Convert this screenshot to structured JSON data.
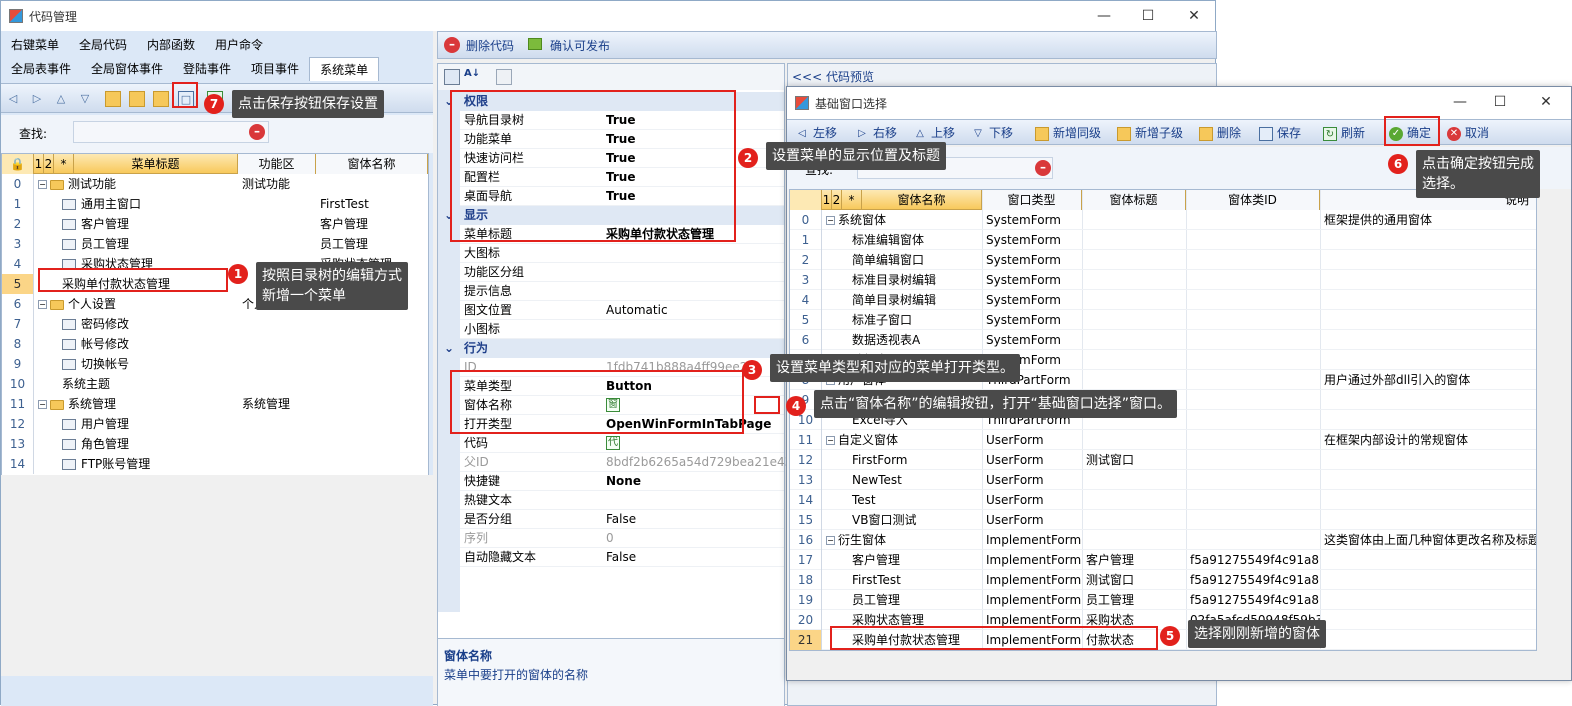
{
  "main_window": {
    "title": "代码管理"
  },
  "left_tabs_row1": [
    "右键菜单",
    "全局代码",
    "内部函数",
    "用户命令"
  ],
  "left_tabs_row2": [
    "全局表事件",
    "全局窗体事件",
    "登陆事件",
    "项目事件",
    "系统菜单"
  ],
  "search": {
    "label": "查找:"
  },
  "left_grid": {
    "headers": [
      "1",
      "2",
      "*",
      "菜单标题",
      "功能区",
      "窗体名称"
    ],
    "rows": [
      {
        "idx": "0",
        "title": "测试功能",
        "area": "测试功能",
        "form": ""
      },
      {
        "idx": "1",
        "title": "通用主窗口",
        "area": "",
        "form": "FirstTest"
      },
      {
        "idx": "2",
        "title": "客户管理",
        "area": "",
        "form": "客户管理"
      },
      {
        "idx": "3",
        "title": "员工管理",
        "area": "",
        "form": "员工管理"
      },
      {
        "idx": "4",
        "title": "采购状态管理",
        "area": "",
        "form": "采购状态管理"
      },
      {
        "idx": "5",
        "title": "采购单付款状态管理",
        "area": "",
        "form": ""
      },
      {
        "idx": "6",
        "title": "个人设置",
        "area": "个人设",
        "form": ""
      },
      {
        "idx": "7",
        "title": "密码修改",
        "area": "",
        "form": ""
      },
      {
        "idx": "8",
        "title": "帐号修改",
        "area": "",
        "form": ""
      },
      {
        "idx": "9",
        "title": "切换帐号",
        "area": "",
        "form": ""
      },
      {
        "idx": "10",
        "title": "系统主题",
        "area": "",
        "form": ""
      },
      {
        "idx": "11",
        "title": "系统管理",
        "area": "系统管理",
        "form": ""
      },
      {
        "idx": "12",
        "title": "用户管理",
        "area": "",
        "form": ""
      },
      {
        "idx": "13",
        "title": "角色管理",
        "area": "",
        "form": ""
      },
      {
        "idx": "14",
        "title": "FTP账号管理",
        "area": "",
        "form": ""
      }
    ]
  },
  "mid_toolbar": {
    "delete_code": "删除代码",
    "confirm_publish": "确认可发布",
    "preview": "<<< 代码预览"
  },
  "property_grid": {
    "cat_permission": "权限",
    "cat_display": "显示",
    "cat_behavior": "行为",
    "props": {
      "nav_tree": {
        "k": "导航目录树",
        "v": "True"
      },
      "func_menu": {
        "k": "功能菜单",
        "v": "True"
      },
      "quick_bar": {
        "k": "快速访问栏",
        "v": "True"
      },
      "config_bar": {
        "k": "配置栏",
        "v": "True"
      },
      "desktop_nav": {
        "k": "桌面导航",
        "v": "True"
      },
      "menu_title": {
        "k": "菜单标题",
        "v": "采购单付款状态管理"
      },
      "big_icon": {
        "k": "大图标",
        "v": ""
      },
      "func_group": {
        "k": "功能区分组",
        "v": ""
      },
      "tip": {
        "k": "提示信息",
        "v": ""
      },
      "img_text_pos": {
        "k": "图文位置",
        "v": "Automatic"
      },
      "small_icon": {
        "k": "小图标",
        "v": ""
      },
      "id": {
        "k": "ID",
        "v": "1fdb741b888a4ff99ee27"
      },
      "menu_type": {
        "k": "菜单类型",
        "v": "Button"
      },
      "form_name": {
        "k": "窗体名称",
        "v": "窗"
      },
      "open_type": {
        "k": "打开类型",
        "v": "OpenWinFormInTabPage"
      },
      "code": {
        "k": "代码",
        "v": "代"
      },
      "parent_id": {
        "k": "父ID",
        "v": "8bdf2b6265a54d729bea21e43"
      },
      "shortcut": {
        "k": "快捷键",
        "v": "None"
      },
      "hotkey_text": {
        "k": "热键文本",
        "v": ""
      },
      "is_group": {
        "k": "是否分组",
        "v": "False"
      },
      "order": {
        "k": "序列",
        "v": "0"
      },
      "auto_hide": {
        "k": "自动隐藏文本",
        "v": "False"
      }
    },
    "desc_title": "窗体名称",
    "desc_text": "菜单中要打开的窗体的名称"
  },
  "dialog": {
    "title": "基础窗口选择",
    "toolbar": [
      "左移",
      "右移",
      "上移",
      "下移",
      "新增同级",
      "新增子级",
      "删除",
      "保存",
      "刷新",
      "确定",
      "取消"
    ],
    "search_label": "查找:",
    "headers": [
      "1",
      "2",
      "*",
      "窗体名称",
      "窗口类型",
      "窗体标题",
      "窗体类ID",
      "说明"
    ],
    "rows": [
      {
        "idx": "0",
        "name": "系统窗体",
        "type": "SystemForm",
        "title": "",
        "cid": "",
        "desc": "框架提供的通用窗体"
      },
      {
        "idx": "1",
        "name": "标准编辑窗体",
        "type": "SystemForm",
        "title": "",
        "cid": "",
        "desc": ""
      },
      {
        "idx": "2",
        "name": "简单编辑窗口",
        "type": "SystemForm",
        "title": "",
        "cid": "",
        "desc": ""
      },
      {
        "idx": "3",
        "name": "标准目录树编辑",
        "type": "SystemForm",
        "title": "",
        "cid": "",
        "desc": ""
      },
      {
        "idx": "4",
        "name": "简单目录树编辑",
        "type": "SystemForm",
        "title": "",
        "cid": "",
        "desc": ""
      },
      {
        "idx": "5",
        "name": "标准子窗口",
        "type": "SystemForm",
        "title": "",
        "cid": "",
        "desc": ""
      },
      {
        "idx": "6",
        "name": "数据透视表A",
        "type": "SystemForm",
        "title": "",
        "cid": "",
        "desc": ""
      },
      {
        "idx": "7",
        "name": "选择窗口",
        "type": "SystemForm",
        "title": "",
        "cid": "",
        "desc": ""
      },
      {
        "idx": "8",
        "name": "用户窗体",
        "type": "ThirdPartForm",
        "title": "",
        "cid": "",
        "desc": "用户通过外部dll引入的窗体"
      },
      {
        "idx": "9",
        "name": "测试窗口",
        "type": "ThirdPartForm",
        "title": "",
        "cid": "",
        "desc": ""
      },
      {
        "idx": "10",
        "name": "Excel导入",
        "type": "ThirdPartForm",
        "title": "",
        "cid": "",
        "desc": ""
      },
      {
        "idx": "11",
        "name": "自定义窗体",
        "type": "UserForm",
        "title": "",
        "cid": "",
        "desc": "在框架内部设计的常规窗体"
      },
      {
        "idx": "12",
        "name": "FirstForm",
        "type": "UserForm",
        "title": "测试窗口",
        "cid": "",
        "desc": ""
      },
      {
        "idx": "13",
        "name": "NewTest",
        "type": "UserForm",
        "title": "",
        "cid": "",
        "desc": ""
      },
      {
        "idx": "14",
        "name": "Test",
        "type": "UserForm",
        "title": "",
        "cid": "",
        "desc": ""
      },
      {
        "idx": "15",
        "name": "VB窗口测试",
        "type": "UserForm",
        "title": "",
        "cid": "",
        "desc": ""
      },
      {
        "idx": "16",
        "name": "衍生窗体",
        "type": "ImplementForm",
        "title": "",
        "cid": "",
        "desc": "这类窗体由上面几种窗体更改名称及标题"
      },
      {
        "idx": "17",
        "name": "客户管理",
        "type": "ImplementForm",
        "title": "客户管理",
        "cid": "f5a91275549f4c91a8ba",
        "desc": ""
      },
      {
        "idx": "18",
        "name": "FirstTest",
        "type": "ImplementForm",
        "title": "测试窗口",
        "cid": "f5a91275549f4c91a8ba",
        "desc": ""
      },
      {
        "idx": "19",
        "name": "员工管理",
        "type": "ImplementForm",
        "title": "员工管理",
        "cid": "f5a91275549f4c91a8ba",
        "desc": ""
      },
      {
        "idx": "20",
        "name": "采购状态管理",
        "type": "ImplementForm",
        "title": "采购状态",
        "cid": "02fa5afcd50948f59b39",
        "desc": ""
      },
      {
        "idx": "21",
        "name": "采购单付款状态管理",
        "type": "ImplementForm",
        "title": "付款状态",
        "cid": "",
        "desc": ""
      }
    ]
  },
  "annotations": {
    "a1": {
      "num": "1",
      "text1": "按照目录树的编辑方式",
      "text2": "新增一个菜单"
    },
    "a2": {
      "num": "2",
      "text": "设置菜单的显示位置及标题"
    },
    "a3": {
      "num": "3",
      "text": "设置菜单类型和对应的菜单打开类型。"
    },
    "a4": {
      "num": "4",
      "text": "点击“窗体名称”的编辑按钮，打开“基础窗口选择”窗口。"
    },
    "a5": {
      "num": "5",
      "text": "选择刚刚新增的窗体"
    },
    "a6": {
      "num": "6",
      "text1": "点击确定按钮完成",
      "text2": "选择。"
    },
    "a7": {
      "num": "7",
      "text": "点击保存按钮保存设置"
    }
  }
}
